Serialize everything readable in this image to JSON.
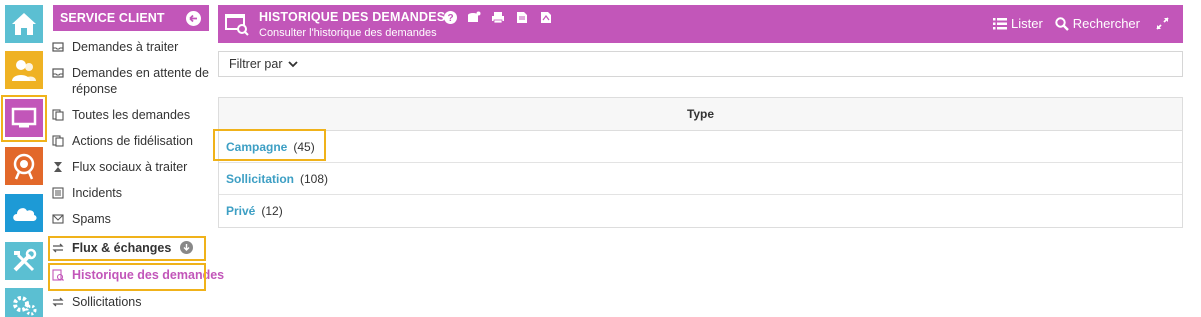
{
  "rail": {
    "items": [
      {
        "name": "home-icon",
        "color": "#5bbfd2"
      },
      {
        "name": "users-icon",
        "color": "#efb223"
      },
      {
        "name": "screen-icon",
        "color": "#c256b9"
      },
      {
        "name": "target-icon",
        "color": "#e2682a"
      },
      {
        "name": "cloud-icon",
        "color": "#1d9ad6"
      },
      {
        "name": "tools-icon",
        "color": "#5bbfd2"
      },
      {
        "name": "gears-icon",
        "color": "#5bbfd2"
      }
    ]
  },
  "sidebar": {
    "title": "SERVICE CLIENT",
    "items": [
      {
        "label": "Demandes à traiter",
        "icon": "inbox-icon"
      },
      {
        "label": "Demandes en attente de réponse",
        "icon": "inbox-wait-icon"
      },
      {
        "label": "Toutes les demandes",
        "icon": "documents-icon"
      },
      {
        "label": "Actions de fidélisation",
        "icon": "documents-icon"
      },
      {
        "label": "Flux sociaux à traiter",
        "icon": "hourglass-icon"
      },
      {
        "label": "Incidents",
        "icon": "list-icon"
      },
      {
        "label": "Spams",
        "icon": "mail-icon"
      },
      {
        "label": "Flux & échanges",
        "icon": "exchange-icon"
      },
      {
        "label": "Historique des demandes",
        "icon": "history-icon"
      },
      {
        "label": "Sollicitations",
        "icon": "exchange-icon"
      }
    ]
  },
  "header": {
    "title": "HISTORIQUE DES DEMANDES",
    "subtitle": "Consulter l'historique des demandes",
    "tools": [
      "help-icon",
      "stack-icon",
      "print-icon",
      "export-icon",
      "pdf-icon"
    ],
    "actions": {
      "list": "Lister",
      "search": "Rechercher"
    }
  },
  "filter": {
    "label": "Filtrer par"
  },
  "table": {
    "column": "Type",
    "rows": [
      {
        "label": "Campagne",
        "count": "(45)"
      },
      {
        "label": "Sollicitation",
        "count": "(108)"
      },
      {
        "label": "Privé",
        "count": "(12)"
      }
    ]
  },
  "colors": {
    "accent": "#c256b9",
    "link": "#3d9fc4",
    "highlight": "#f0b21a"
  }
}
